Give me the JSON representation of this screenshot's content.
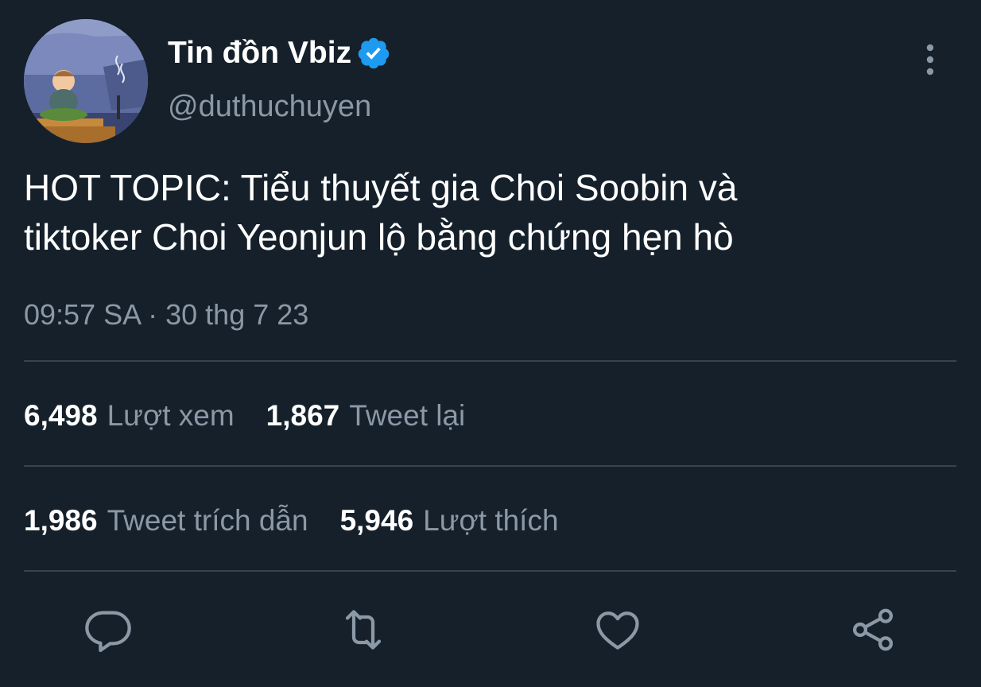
{
  "author": {
    "display_name": "Tin đồn Vbiz",
    "handle": "@duthuchuyen",
    "verified_icon": "verified-badge-icon",
    "avatar": "cartoon-character-meditating-avatar"
  },
  "tweet": {
    "text_line1": "HOT TOPIC: Tiểu thuyết gia Choi Soobin và",
    "text_line2": "tiktoker Choi Yeonjun lộ bằng chứng hẹn hò",
    "timestamp": "09:57 SA · 30 thg 7 23"
  },
  "stats": {
    "views": {
      "value": "6,498",
      "label": "Lượt xem"
    },
    "retweets": {
      "value": "1,867",
      "label": "Tweet lại"
    },
    "quotes": {
      "value": "1,986",
      "label": "Tweet trích dẫn"
    },
    "likes": {
      "value": "5,946",
      "label": "Lượt thích"
    }
  },
  "actions": {
    "reply": "reply-icon",
    "retweet": "retweet-icon",
    "like": "heart-icon",
    "share": "share-icon",
    "more": "more-vertical-icon"
  },
  "colors": {
    "background": "#15202b",
    "text_primary": "#ffffff",
    "text_secondary": "#8b98a5",
    "divider": "#38444d",
    "verified": "#1d9bf0"
  }
}
